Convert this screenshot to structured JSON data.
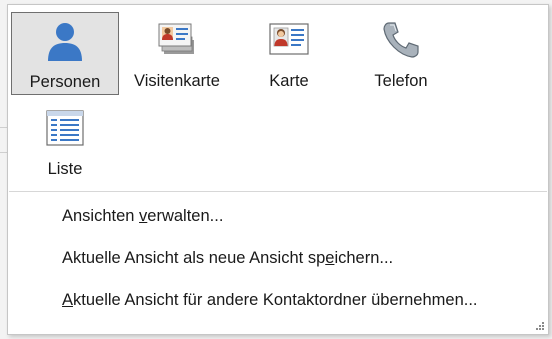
{
  "views": [
    {
      "label": "Personen",
      "icon": "person-icon",
      "selected": true
    },
    {
      "label": "Visitenkarte",
      "icon": "business-card-icon",
      "selected": false
    },
    {
      "label": "Karte",
      "icon": "contact-card-icon",
      "selected": false
    },
    {
      "label": "Telefon",
      "icon": "phone-icon",
      "selected": false
    },
    {
      "label": "Liste",
      "icon": "list-icon",
      "selected": false
    }
  ],
  "menu": {
    "manage_views": {
      "prefix": "Ansichten ",
      "accel": "v",
      "suffix": "erwalten..."
    },
    "save_view": {
      "prefix": "Aktuelle Ansicht als neue Ansicht sp",
      "accel": "e",
      "suffix": "ichern..."
    },
    "apply_view": {
      "prefix": "",
      "accel": "A",
      "suffix": "ktuelle Ansicht für andere Kontaktordner übernehmen..."
    }
  },
  "colors": {
    "accent_blue": "#3b78c6",
    "selected_bg": "#e3e3e3",
    "selected_border": "#6f6f6f"
  }
}
